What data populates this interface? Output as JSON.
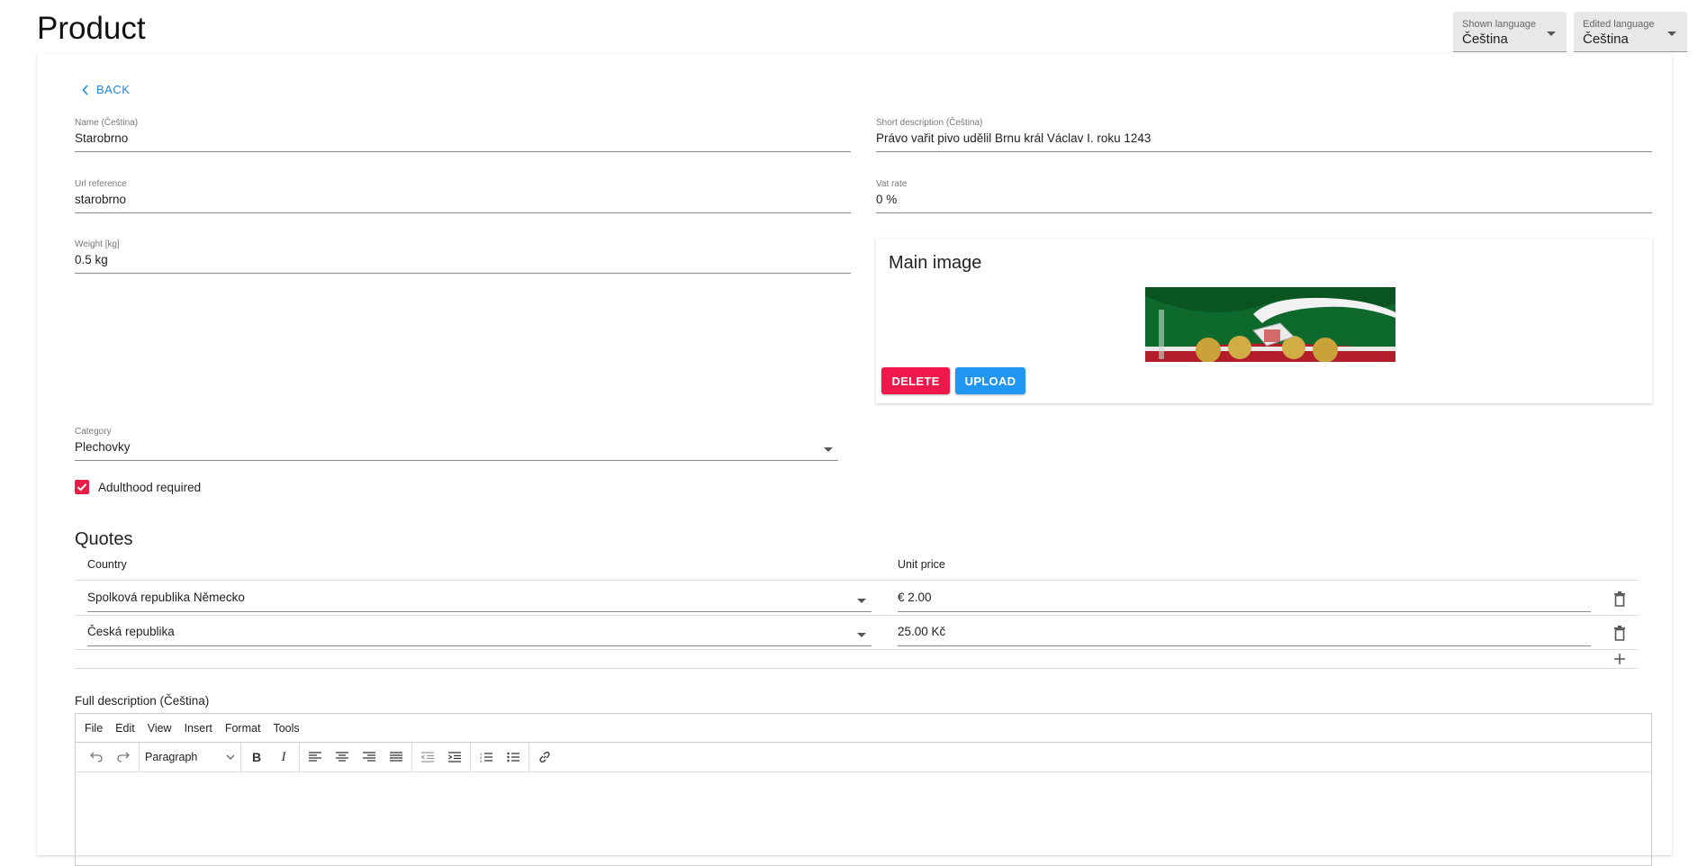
{
  "page": {
    "title": "Product"
  },
  "language": {
    "shown": {
      "label": "Shown language",
      "value": "Čeština"
    },
    "edited": {
      "label": "Edited language",
      "value": "Čeština"
    }
  },
  "form": {
    "back_label": "BACK",
    "name": {
      "label": "Name (Čeština)",
      "value": "Starobrno"
    },
    "short_description": {
      "label": "Short description (Čeština)",
      "value": "Právo vařit pivo udělil Brnu král Václav I. roku 1243"
    },
    "url_reference": {
      "label": "Url reference",
      "value": "starobrno"
    },
    "vat_rate": {
      "label": "Vat rate",
      "value": "0 %"
    },
    "weight": {
      "label": "Weight [kg]",
      "value": "0.5 kg"
    },
    "category": {
      "label": "Category",
      "value": "Plechovky"
    },
    "adulthood": {
      "label": "Adulthood required",
      "checked": true
    }
  },
  "main_image": {
    "title": "Main image",
    "delete_label": "DELETE",
    "upload_label": "UPLOAD"
  },
  "quotes": {
    "title": "Quotes",
    "headers": {
      "country": "Country",
      "unit_price": "Unit price"
    },
    "rows": [
      {
        "country": "Spolková republika Německo",
        "price": "€ 2.00"
      },
      {
        "country": "Česká republika",
        "price": "25.00 Kč"
      }
    ]
  },
  "editor": {
    "title": "Full description (Čeština)",
    "menu": [
      "File",
      "Edit",
      "View",
      "Insert",
      "Format",
      "Tools"
    ],
    "block_format": "Paragraph"
  },
  "colors": {
    "accent_blue": "#1e88e5",
    "delete_red": "#f0184a",
    "upload_blue": "#2196f3",
    "checkbox_red": "#e91e48"
  }
}
